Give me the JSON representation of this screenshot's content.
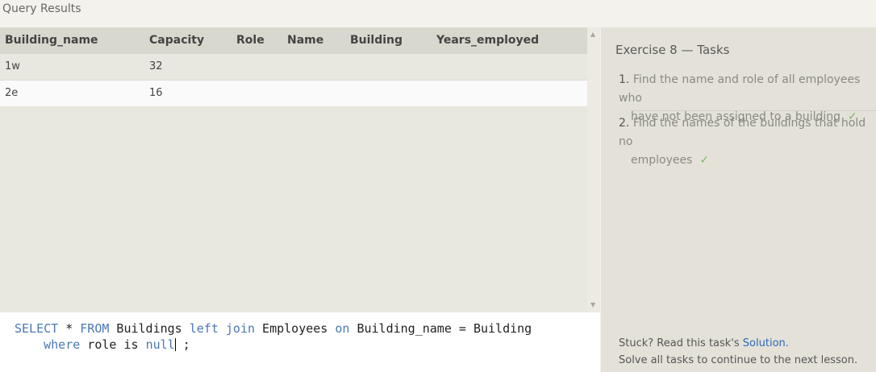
{
  "header": {
    "title": "Query Results"
  },
  "table": {
    "columns": [
      "Building_name",
      "Capacity",
      "Role",
      "Name",
      "Building",
      "Years_employed"
    ],
    "rows": [
      [
        "1w",
        "32",
        "",
        "",
        "",
        ""
      ],
      [
        "2e",
        "16",
        "",
        "",
        "",
        ""
      ]
    ]
  },
  "editor": {
    "line1": {
      "kw_select": "SELECT",
      "star": " * ",
      "kw_from": "FROM",
      "t1": " Buildings ",
      "kw_left_join": "left join",
      "t2": " Employees ",
      "kw_on": "on",
      "t3": " Building_name = Building"
    },
    "line2": {
      "indent": "    ",
      "kw_where": "where",
      "t1": " role is ",
      "kw_null": "null",
      "t2": " ;"
    }
  },
  "tasks_panel": {
    "title": "Exercise 8 — Tasks",
    "tasks": [
      {
        "number": "1.",
        "line1": "Find the name and role of all employees who",
        "line2": "have not been assigned to a building",
        "status": "✓"
      },
      {
        "number": "2.",
        "line1": "Find the names of the buildings that hold no",
        "line2": "employees",
        "status": "✓"
      }
    ],
    "footer_prefix": "Stuck? Read this task's ",
    "solution_link": "Solution.",
    "footer_line2": "Solve all tasks to continue to the next lesson."
  },
  "colors": {
    "accent_link": "#2e66b8",
    "keyword": "#4a78b5",
    "check": "#7fb56a",
    "header_bg": "#d9d8cf",
    "panel_bg": "#e4e2d8"
  },
  "icons": {
    "scroll_up": "triangle-up-icon",
    "scroll_down": "triangle-down-icon",
    "task_check": "checkmark-icon"
  }
}
